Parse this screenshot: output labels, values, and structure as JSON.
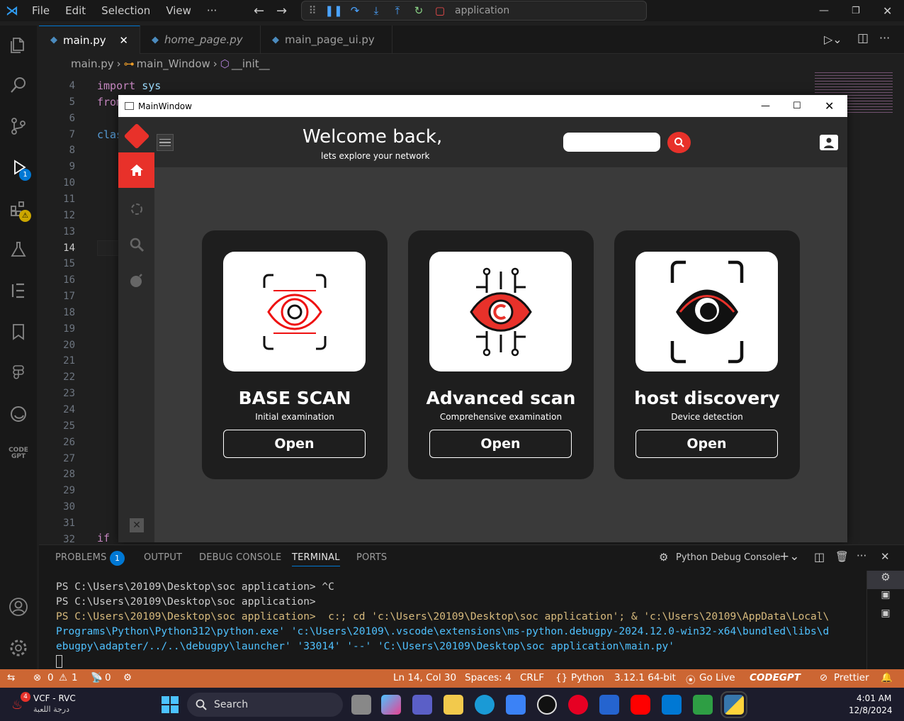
{
  "titlebar": {
    "menus": [
      "File",
      "Edit",
      "Selection",
      "View",
      "···"
    ],
    "command_center": "application"
  },
  "activity": {
    "debug_badge": "1",
    "code_gpt": "CODE\nGPT"
  },
  "tabs": [
    {
      "label": "main.py",
      "active": true
    },
    {
      "label": "home_page.py",
      "active": false
    },
    {
      "label": "main_page_ui.py",
      "active": false
    }
  ],
  "breadcrumb": {
    "file": "main.py",
    "class": "main_Window",
    "method": "__init__"
  },
  "editor": {
    "line_numbers": [
      "4",
      "5",
      "6",
      "7",
      "8",
      "9",
      "10",
      "11",
      "12",
      "13",
      "14",
      "15",
      "16",
      "17",
      "18",
      "19",
      "20",
      "21",
      "22",
      "23",
      "24",
      "25",
      "26",
      "27",
      "28",
      "29",
      "30",
      "31",
      "32"
    ],
    "code": {
      "l4_kw": "import",
      "l4_rest": " sys",
      "l5": "from",
      "l7": "clas",
      "l32": "if"
    }
  },
  "qt": {
    "window_title": "MainWindow",
    "welcome": "Welcome back,",
    "subtitle": "lets explore your network",
    "cards": [
      {
        "title": "BASE SCAN",
        "sub": "Initial examination",
        "btn": "Open"
      },
      {
        "title": "Advanced scan",
        "sub": "Comprehensive examination",
        "btn": "Open"
      },
      {
        "title": "host discovery",
        "sub": "Device detection",
        "btn": "Open"
      }
    ]
  },
  "panel": {
    "tabs": [
      "PROBLEMS",
      "OUTPUT",
      "DEBUG CONSOLE",
      "TERMINAL",
      "PORTS"
    ],
    "problems_count": "1",
    "terminal_name": "Python Debug Console",
    "lines": [
      "PS C:\\Users\\20109\\Desktop\\soc application> ^C",
      "PS C:\\Users\\20109\\Desktop\\soc application>",
      "PS C:\\Users\\20109\\Desktop\\soc application>  c:; cd 'c:\\Users\\20109\\Desktop\\soc application'; & 'c:\\Users\\20109\\AppData\\Local\\",
      "Programs\\Python\\Python312\\python.exe' 'c:\\Users\\20109\\.vscode\\extensions\\ms-python.debugpy-2024.12.0-win32-x64\\bundled\\libs\\d",
      "ebugpy\\adapter/../..\\debugpy\\launcher' '33014' '--' 'C:\\Users\\20109\\Desktop\\soc application\\main.py'"
    ]
  },
  "status": {
    "errors": "0",
    "warnings": "1",
    "ports": "0",
    "position": "Ln 14, Col 30",
    "spaces": "Spaces: 4",
    "eol": "CRLF",
    "language": "Python",
    "interpreter": "3.12.1 64-bit",
    "go_live": "Go Live",
    "codegpt": "CODEGPT",
    "prettier": "Prettier"
  },
  "taskbar": {
    "weather_title": "VCF - RVC",
    "weather_sub": "درجة اللعبة",
    "weather_badge": "4",
    "search": "Search",
    "time": "4:01 AM",
    "date": "12/8/2024"
  },
  "colors": {
    "accent_red": "#e8312a",
    "status_bar": "#cc6633",
    "vscode_blue": "#0078d4"
  }
}
